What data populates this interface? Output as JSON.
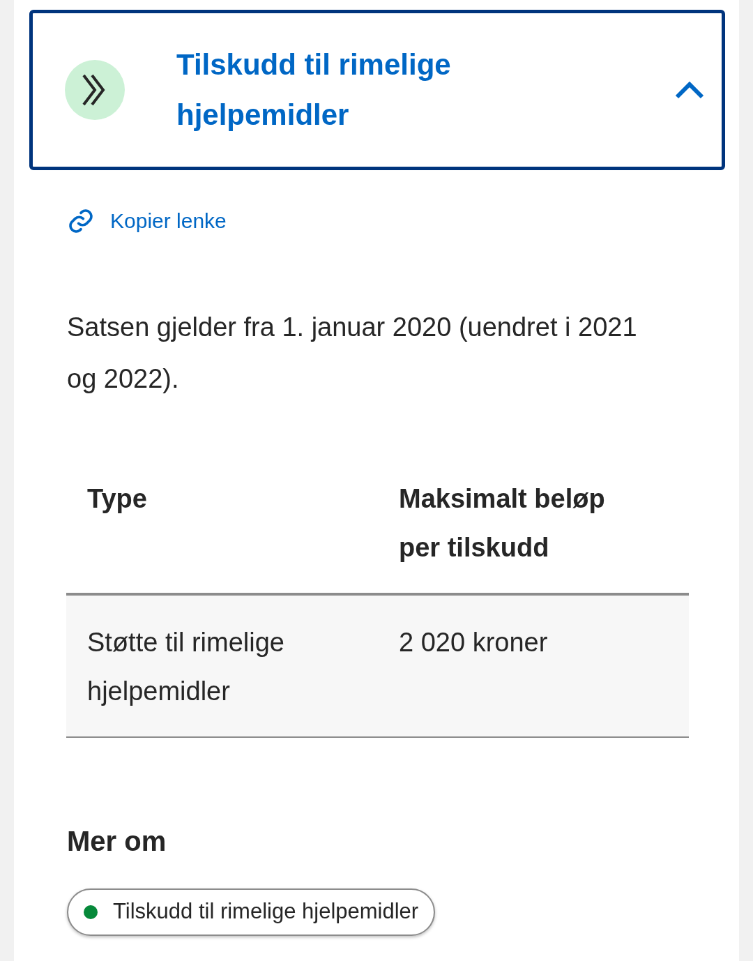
{
  "accordion": {
    "title": "Tilskudd til rimelige hjelpemidler",
    "expanded": true
  },
  "copy_link": "Kopier lenke",
  "paragraph": "Satsen gjelder fra 1. januar 2020 (uendret i 2021 og 2022).",
  "table": {
    "columns": [
      "Type",
      "Maksimalt beløp per tilskudd"
    ],
    "rows": [
      [
        "Støtte til rimelige hjelpemidler",
        "2 020 kroner"
      ]
    ]
  },
  "more": {
    "heading": "Mer om",
    "tags": [
      {
        "label": "Tilskudd til rimelige hjelpemidler",
        "color": "#06893a"
      }
    ]
  }
}
